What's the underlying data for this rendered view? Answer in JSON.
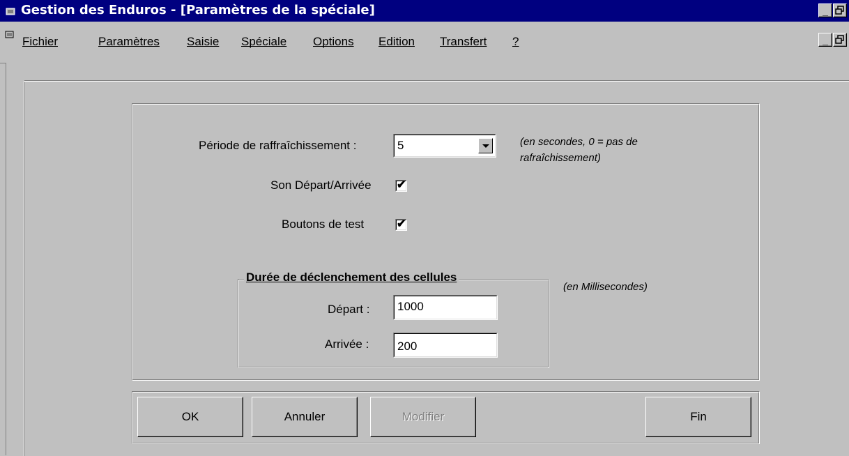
{
  "window": {
    "title": "Gestion des Enduros - [Paramètres de la spéciale]",
    "minimize_glyph": "_",
    "restore_glyph": "🗗"
  },
  "menu": {
    "items": [
      {
        "label": "Fichier"
      },
      {
        "label": "Paramètres"
      },
      {
        "label": "Saisie"
      },
      {
        "label": "Spéciale"
      },
      {
        "label": "Options"
      },
      {
        "label": "Edition"
      },
      {
        "label": "Transfert"
      },
      {
        "label": "?"
      }
    ]
  },
  "form": {
    "refresh_label": "Période de raffraîchissement :",
    "refresh_value": "5",
    "refresh_note_line1": "(en secondes, 0 = pas de",
    "refresh_note_line2": "rafraîchissement)",
    "sound_label": "Son Départ/Arrivée",
    "sound_checked": true,
    "test_buttons_label": "Boutons de test",
    "test_buttons_checked": true,
    "cells_group_title": "Durée de déclenchement des cellules",
    "cells_note": "(en Millisecondes)",
    "depart_label": "Départ :",
    "depart_value": "1000",
    "arrivee_label": "Arrivée :",
    "arrivee_value": "200"
  },
  "buttons": {
    "ok": "OK",
    "annuler": "Annuler",
    "modifier": "Modifier",
    "fin": "Fin"
  }
}
